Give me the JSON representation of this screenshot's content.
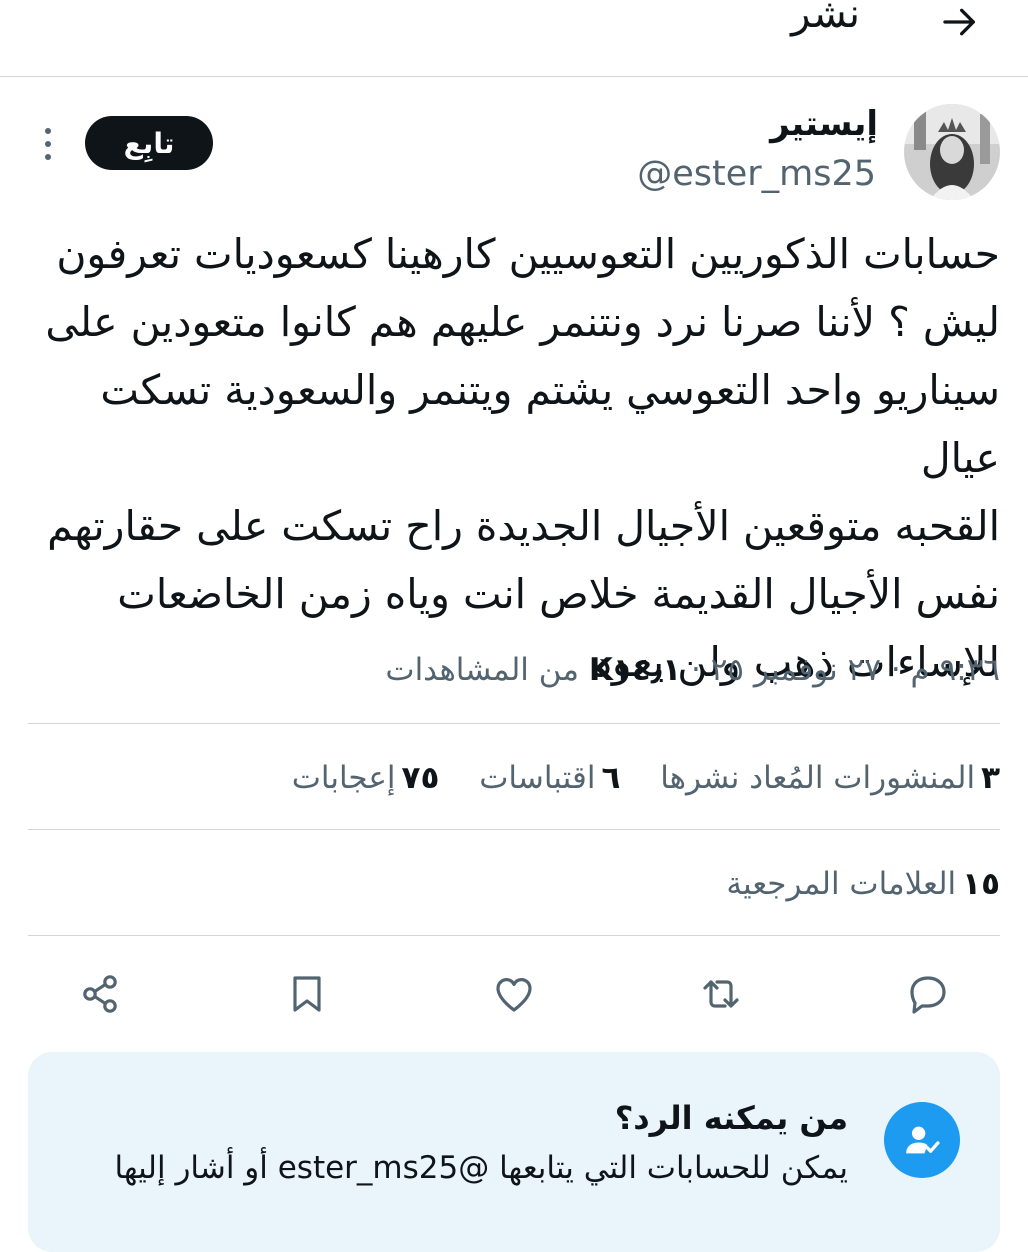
{
  "header": {
    "title": "نشر"
  },
  "author": {
    "display_name": "إيستير",
    "handle": "@ester_ms25",
    "follow_label": "تابِع"
  },
  "tweet": {
    "text": "حسابات الذكوريين التعوسيين كارهينا كسعوديات تعرفون\nليش ؟ لأننا صرنا نرد ونتنمر عليهم هم كانوا متعودين على\nسيناريو واحد التعوسي يشتم ويتنمر والسعودية تسكت عيال\nالقحبه متوقعين الأجيال الجديدة راح تسكت على حقارتهم\nنفس الأجيال القديمة خلاص انت وياه زمن الخاضعات\nللإساءات ذهب ولن يعود",
    "time": "٩:٣٦ م",
    "date": "٢٧ نوفمبر ٢٥",
    "views_count": "K١٤٫١",
    "views_label": "من المشاهدات",
    "separator": "·"
  },
  "stats": {
    "reposts_count": "٣",
    "reposts_label": "المنشورات المُعاد نشرها",
    "quotes_count": "٦",
    "quotes_label": "اقتباسات",
    "likes_count": "٧٥",
    "likes_label": "إعجابات",
    "bookmarks_count": "١٥",
    "bookmarks_label": "العلامات المرجعية"
  },
  "actions": [
    "reply-icon",
    "repost-icon",
    "like-icon",
    "bookmark-icon",
    "share-icon"
  ],
  "reply_settings": {
    "title": "من يمكنه الرد؟",
    "description": "يمكن للحسابات التي يتابعها @ester_ms25 أو أشار إليها"
  },
  "colors": {
    "text": "#0f1419",
    "secondary": "#536471",
    "accent": "#1d9bf0",
    "reply_box_bg": "#eaf4fb",
    "follow_button": "#0f1419"
  }
}
